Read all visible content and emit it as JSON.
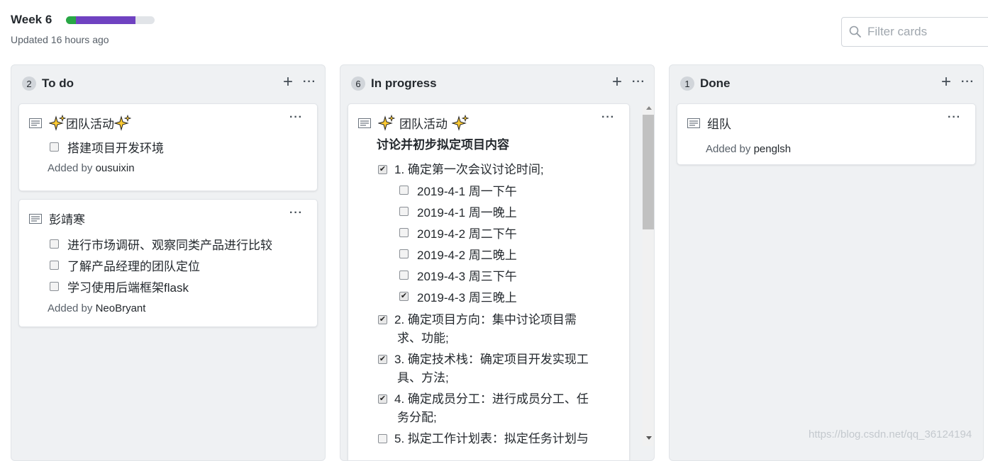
{
  "header": {
    "title": "Week 6",
    "updated": "Updated 16 hours ago",
    "progress": {
      "done_fraction": 0.111,
      "in_progress_fraction": 0.667
    },
    "colors": {
      "done": "#28a745",
      "in_progress": "#6f42c1"
    }
  },
  "filter": {
    "placeholder": "Filter cards"
  },
  "columns": [
    {
      "count": "2",
      "name": "To do",
      "cards": [
        {
          "title": "团队活动",
          "tasks": [
            {
              "label": "搭建项目开发环境",
              "checked": false
            }
          ],
          "added_prefix": "Added by ",
          "author": "ousuixin"
        },
        {
          "title": "彭靖寒",
          "tasks": [
            {
              "label": "进行市场调研、观察同类产品进行比较",
              "checked": false
            },
            {
              "label": "了解产品经理的团队定位",
              "checked": false
            },
            {
              "label": "学习使用后端框架flask",
              "checked": false
            }
          ],
          "added_prefix": "Added by ",
          "author": "NeoBryant"
        }
      ]
    },
    {
      "count": "6",
      "name": "In progress",
      "cards": [
        {
          "title": "团队活动",
          "subtitle": "讨论并初步拟定项目内容",
          "tasks": [
            {
              "label": "1. 确定第一次会议讨论时间;",
              "checked": true,
              "subtasks": [
                {
                  "label": "2019-4-1 周一下午",
                  "checked": false
                },
                {
                  "label": "2019-4-1 周一晚上",
                  "checked": false
                },
                {
                  "label": "2019-4-2 周二下午",
                  "checked": false
                },
                {
                  "label": "2019-4-2 周二晚上",
                  "checked": false
                },
                {
                  "label": "2019-4-3 周三下午",
                  "checked": false
                },
                {
                  "label": "2019-4-3 周三晚上",
                  "checked": true
                }
              ]
            },
            {
              "label": "2. 确定项目方向：集中讨论项目需求、功能;",
              "checked": true,
              "line1": "2. 确定项目方向：集中讨论项目需",
              "line2": "求、功能;"
            },
            {
              "label": "3. 确定技术栈：确定项目开发实现工具、方法;",
              "checked": true,
              "line1": "3. 确定技术栈：确定项目开发实现工",
              "line2": "具、方法;"
            },
            {
              "label": "4. 确定成员分工：进行成员分工、任务分配;",
              "checked": true,
              "line1": "4. 确定成员分工：进行成员分工、任",
              "line2": "务分配;"
            },
            {
              "label": "5. 拟定工作计划表：拟定任务计划与",
              "checked": false,
              "line1": "5. 拟定工作计划表：拟定任务计划与"
            }
          ]
        }
      ]
    },
    {
      "count": "1",
      "name": "Done",
      "cards": [
        {
          "title": "组队",
          "added_prefix": "Added by ",
          "author": "penglsh"
        }
      ]
    }
  ],
  "icons": {
    "card": "note-icon",
    "sparkle": "sparkles-icon",
    "add": "plus-icon",
    "menu": "kebab-horizontal-icon",
    "search": "search-icon"
  },
  "watermark": "https://blog.csdn.net/qq_36124194"
}
